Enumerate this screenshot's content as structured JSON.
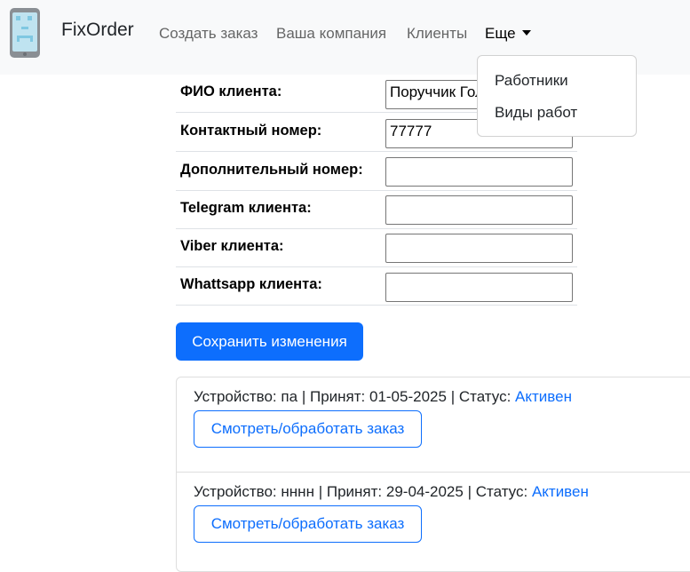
{
  "navbar": {
    "brand": "FixOrder",
    "links": [
      "Создать заказ",
      "Ваша компания",
      "Клиенты"
    ],
    "more_label": "Еще",
    "dropdown_items": [
      "Работники",
      "Виды работ"
    ]
  },
  "client_form": {
    "fields": [
      {
        "label": "ФИО клиента:",
        "value": "Поруччик Голицын"
      },
      {
        "label": "Контактный номер:",
        "value": "77777"
      },
      {
        "label": "Дополнительный номер:",
        "value": ""
      },
      {
        "label": "Telegram клиента:",
        "value": ""
      },
      {
        "label": "Viber клиента:",
        "value": ""
      },
      {
        "label": "Whattsapp клиента:",
        "value": ""
      }
    ],
    "save_label": "Сохранить изменения"
  },
  "orders": [
    {
      "device_label": "Устройство:",
      "device": "па",
      "accepted_label": "Принят:",
      "accepted_date": "01-05-2025",
      "status_label": "Статус:",
      "status": "Активен",
      "button_label": "Смотреть/обработать заказ"
    },
    {
      "device_label": "Устройство:",
      "device": "нннн",
      "accepted_label": "Принят:",
      "accepted_date": "29-04-2025",
      "status_label": "Статус:",
      "status": "Активен",
      "button_label": "Смотреть/обработать заказ"
    }
  ],
  "colors": {
    "primary": "#0d6efd",
    "navbar_bg": "#f8f9fa",
    "border": "#dee2e6"
  }
}
